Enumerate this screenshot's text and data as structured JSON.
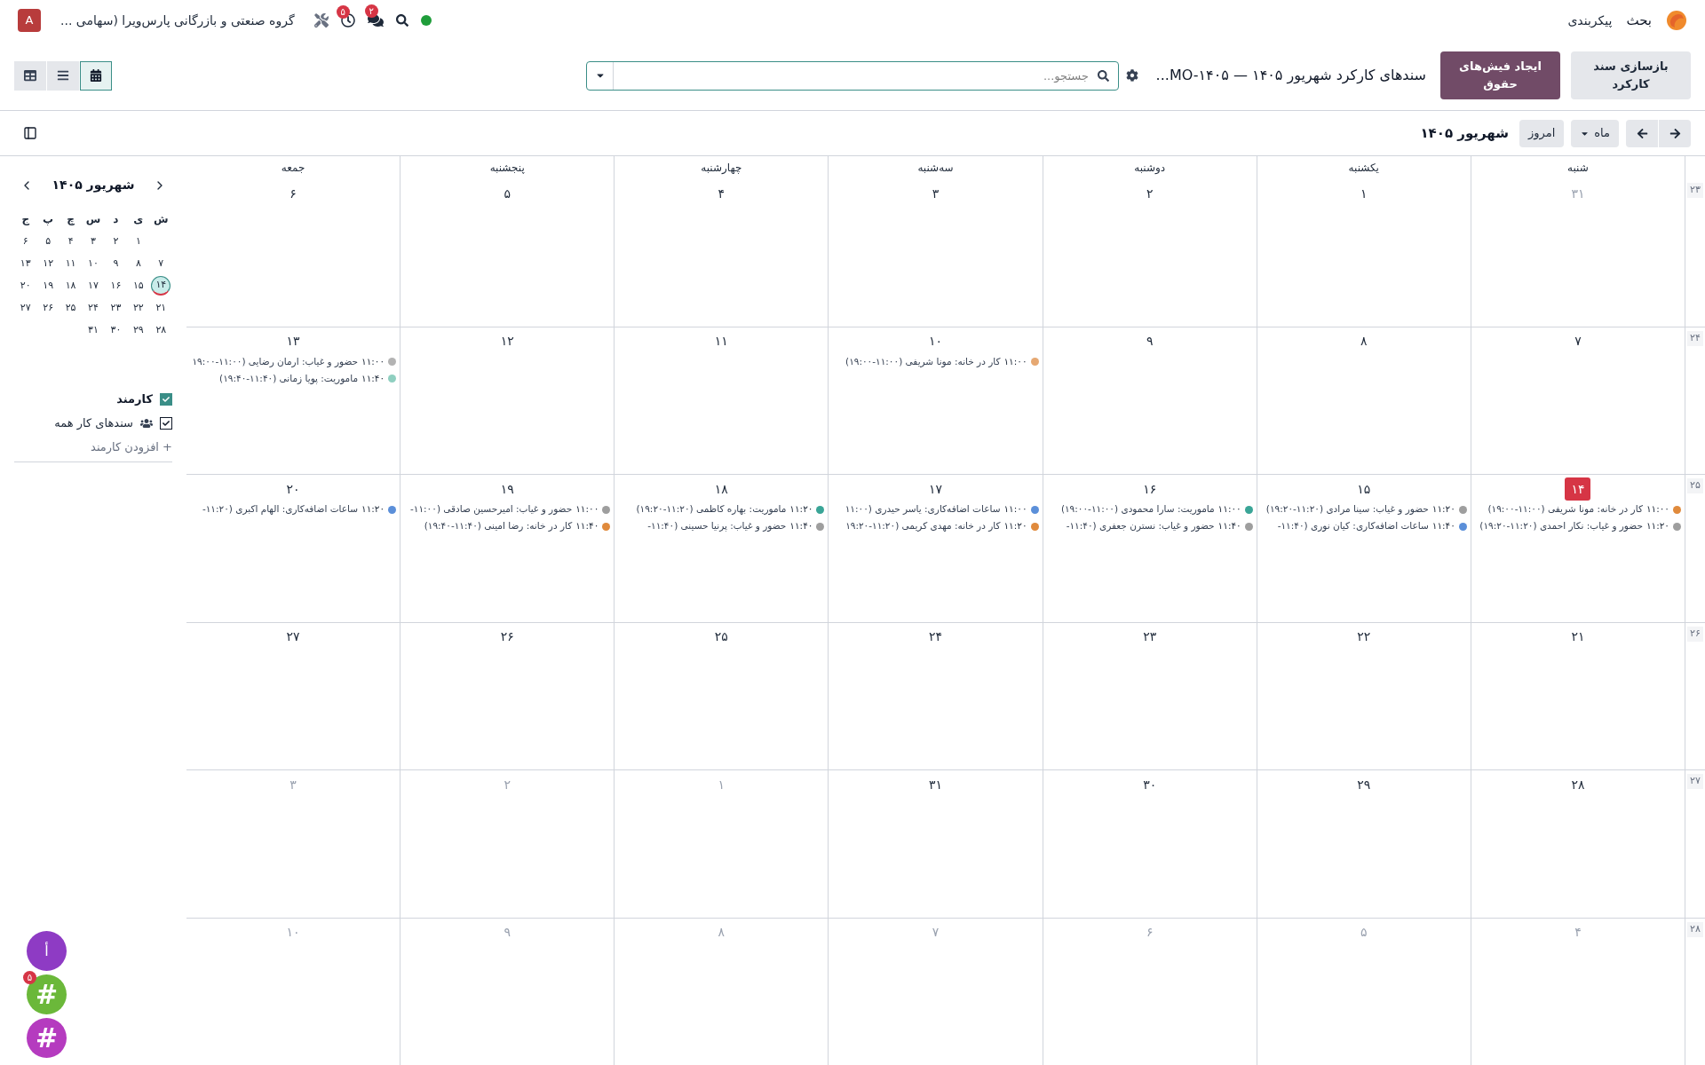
{
  "navbar": {
    "app_name": "بحث",
    "menus": [
      "پیکربندی"
    ],
    "chat_badge": "۲",
    "activity_badge": "۵",
    "company": "گروه صنعتی و بازرگانی پارس‌ویرا (سهامی ...",
    "avatar": "A"
  },
  "control_panel": {
    "buttons": [
      {
        "label": "بازسازی سند کارکرد",
        "kind": "secondary"
      },
      {
        "label": "ایجاد فیش‌های حقوق",
        "kind": "primary"
      }
    ],
    "title": "سندهای کارکرد شهریور ۱۴۰۵ — MO-۱۴۰۵...",
    "search": {
      "placeholder": "جستجو..."
    },
    "views": [
      {
        "kind": "calendar",
        "selected": true
      },
      {
        "kind": "list",
        "selected": false
      },
      {
        "kind": "pivot",
        "selected": false
      }
    ]
  },
  "calendar_toolbar": {
    "scale": "ماه",
    "today": "امروز",
    "period": "شهریور ۱۴۰۵"
  },
  "calendar": {
    "weekdays": [
      "شنبه",
      "یکشنبه",
      "دوشنبه",
      "سه‌شنبه",
      "چهارشنبه",
      "پنجشنبه",
      "جمعه"
    ],
    "weeks": [
      {
        "number": "۲۳",
        "days": [
          {
            "date": "۳۱",
            "other_month": true,
            "today": false
          },
          {
            "date": "۱",
            "other_month": false,
            "today": false
          },
          {
            "date": "۲",
            "other_month": false,
            "today": false
          },
          {
            "date": "۳",
            "other_month": false,
            "today": false
          },
          {
            "date": "۴",
            "other_month": false,
            "today": false
          },
          {
            "date": "۵",
            "other_month": false,
            "today": false
          },
          {
            "date": "۶",
            "other_month": false,
            "today": false
          }
        ]
      },
      {
        "number": "۲۴",
        "days": [
          {
            "date": "۷",
            "other_month": false,
            "today": false
          },
          {
            "date": "۸",
            "other_month": false,
            "today": false
          },
          {
            "date": "۹",
            "other_month": false,
            "today": false
          },
          {
            "date": "۱۰",
            "other_month": false,
            "today": false,
            "events": [
              {
                "time": "۱۱:۰۰",
                "title": "کار در خانه: مونا شریفی (۱۱:۰۰-۱۹:۰۰)",
                "color": "#e6a872"
              }
            ]
          },
          {
            "date": "۱۱",
            "other_month": false,
            "today": false
          },
          {
            "date": "۱۲",
            "other_month": false,
            "today": false
          },
          {
            "date": "۱۳",
            "other_month": false,
            "today": false,
            "events": [
              {
                "time": "۱۱:۰۰",
                "title": "حضور و غیاب: ارمان رضایی (۱۱:۰۰-۱۹:۰۰",
                "color": "#b3b3b3"
              },
              {
                "time": "۱۱:۴۰",
                "title": "ماموریت: پویا زمانی (۱۱:۴۰-۱۹:۴۰)",
                "color": "#8fcfc0"
              }
            ]
          }
        ]
      },
      {
        "number": "۲۵",
        "days": [
          {
            "date": "۱۴",
            "other_month": false,
            "today": true,
            "events": [
              {
                "time": "۱۱:۰۰",
                "title": "کار در خانه: مونا شریفی (۱۱:۰۰-۱۹:۰۰)",
                "color": "#e08a3c"
              },
              {
                "time": "۱۱:۲۰",
                "title": "حضور و غیاب: نکار احمدی (۱۱:۲۰-۱۹:۲۰)",
                "color": "#9e9e9e"
              }
            ]
          },
          {
            "date": "۱۵",
            "other_month": false,
            "today": false,
            "events": [
              {
                "time": "۱۱:۲۰",
                "title": "حضور و غیاب: سینا مرادی (۱۱:۲۰-۱۹:۲۰)",
                "color": "#9e9e9e"
              },
              {
                "time": "۱۱:۴۰",
                "title": "ساعات اضافه‌کاری: کیان نوری (۱۱:۴۰-",
                "color": "#5b8fd9"
              }
            ]
          },
          {
            "date": "۱۶",
            "other_month": false,
            "today": false,
            "events": [
              {
                "time": "۱۱:۰۰",
                "title": "ماموریت: سارا محمودی (۱۱:۰۰-۱۹:۰۰)",
                "color": "#3aa597"
              },
              {
                "time": "۱۱:۴۰",
                "title": "حضور و غیاب: نسترن جعفری (۱۱:۴۰-",
                "color": "#9e9e9e"
              }
            ]
          },
          {
            "date": "۱۷",
            "other_month": false,
            "today": false,
            "events": [
              {
                "time": "۱۱:۰۰",
                "title": "ساعات اضافه‌کاری: یاسر حیدری (۱۱:۰۰",
                "color": "#5b8fd9"
              },
              {
                "time": "۱۱:۲۰",
                "title": "کار در خانه: مهدی کریمی (۱۱:۲۰-۱۹:۲۰",
                "color": "#e08a3c"
              }
            ]
          },
          {
            "date": "۱۸",
            "other_month": false,
            "today": false,
            "events": [
              {
                "time": "۱۱:۲۰",
                "title": "ماموریت: بهاره کاظمی (۱۱:۲۰-۱۹:۲۰)",
                "color": "#3aa597"
              },
              {
                "time": "۱۱:۴۰",
                "title": "حضور و غیاب: پرنیا حسینی (۱۱:۴۰-",
                "color": "#9e9e9e"
              }
            ]
          },
          {
            "date": "۱۹",
            "other_month": false,
            "today": false,
            "events": [
              {
                "time": "۱۱:۰۰",
                "title": "حضور و غیاب: امیرحسین صادقی (۱۱:۰۰-",
                "color": "#9e9e9e"
              },
              {
                "time": "۱۱:۴۰",
                "title": "کار در خانه: رضا امینی (۱۱:۴۰-۱۹:۴۰)",
                "color": "#e08a3c"
              }
            ]
          },
          {
            "date": "۲۰",
            "other_month": false,
            "today": false,
            "events": [
              {
                "time": "۱۱:۲۰",
                "title": "ساعات اضافه‌کاری: الهام اکبری (۱۱:۲۰-",
                "color": "#5b8fd9"
              }
            ]
          }
        ]
      },
      {
        "number": "۲۶",
        "days": [
          {
            "date": "۲۱",
            "other_month": false,
            "today": false
          },
          {
            "date": "۲۲",
            "other_month": false,
            "today": false
          },
          {
            "date": "۲۳",
            "other_month": false,
            "today": false
          },
          {
            "date": "۲۴",
            "other_month": false,
            "today": false
          },
          {
            "date": "۲۵",
            "other_month": false,
            "today": false
          },
          {
            "date": "۲۶",
            "other_month": false,
            "today": false
          },
          {
            "date": "۲۷",
            "other_month": false,
            "today": false
          }
        ]
      },
      {
        "number": "۲۷",
        "days": [
          {
            "date": "۲۸",
            "other_month": false,
            "today": false
          },
          {
            "date": "۲۹",
            "other_month": false,
            "today": false
          },
          {
            "date": "۳۰",
            "other_month": false,
            "today": false
          },
          {
            "date": "۳۱",
            "other_month": false,
            "today": false
          },
          {
            "date": "۱",
            "other_month": true,
            "today": false
          },
          {
            "date": "۲",
            "other_month": true,
            "today": false
          },
          {
            "date": "۳",
            "other_month": true,
            "today": false
          }
        ]
      },
      {
        "number": "۲۸",
        "days": [
          {
            "date": "۴",
            "other_month": true,
            "today": false
          },
          {
            "date": "۵",
            "other_month": true,
            "today": false
          },
          {
            "date": "۶",
            "other_month": true,
            "today": false
          },
          {
            "date": "۷",
            "other_month": true,
            "today": false
          },
          {
            "date": "۸",
            "other_month": true,
            "today": false
          },
          {
            "date": "۹",
            "other_month": true,
            "today": false
          },
          {
            "date": "۱۰",
            "other_month": true,
            "today": false
          }
        ]
      }
    ]
  },
  "sidebar": {
    "mini_calendar": {
      "title": "شهریور ۱۴۰۵",
      "weekdays": [
        "ش",
        "ی",
        "د",
        "س",
        "چ",
        "پ",
        "ج"
      ],
      "weeks": [
        {
          "kind": "start",
          "days": [
            {
              "date": "۱",
              "selected": false
            },
            {
              "date": "۲",
              "selected": false
            },
            {
              "date": "۳",
              "selected": false
            },
            {
              "date": "۴",
              "selected": false
            },
            {
              "date": "۵",
              "selected": false
            },
            {
              "date": "۶",
              "selected": false
            }
          ]
        },
        {
          "kind": "full",
          "days": [
            {
              "date": "۷",
              "selected": false
            },
            {
              "date": "۸",
              "selected": false
            },
            {
              "date": "۹",
              "selected": false
            },
            {
              "date": "۱۰",
              "selected": false
            },
            {
              "date": "۱۱",
              "selected": false
            },
            {
              "date": "۱۲",
              "selected": false
            },
            {
              "date": "۱۳",
              "selected": false
            }
          ]
        },
        {
          "kind": "full",
          "days": [
            {
              "date": "۱۴",
              "selected": true
            },
            {
              "date": "۱۵",
              "selected": false
            },
            {
              "date": "۱۶",
              "selected": false
            },
            {
              "date": "۱۷",
              "selected": false
            },
            {
              "date": "۱۸",
              "selected": false
            },
            {
              "date": "۱۹",
              "selected": false
            },
            {
              "date": "۲۰",
              "selected": false
            }
          ]
        },
        {
          "kind": "full",
          "days": [
            {
              "date": "۲۱",
              "selected": false
            },
            {
              "date": "۲۲",
              "selected": false
            },
            {
              "date": "۲۳",
              "selected": false
            },
            {
              "date": "۲۴",
              "selected": false
            },
            {
              "date": "۲۵",
              "selected": false
            },
            {
              "date": "۲۶",
              "selected": false
            },
            {
              "date": "۲۷",
              "selected": false
            }
          ]
        },
        {
          "kind": "end",
          "days": [
            {
              "date": "۲۸",
              "selected": false
            },
            {
              "date": "۲۹",
              "selected": false
            },
            {
              "date": "۳۰",
              "selected": false
            },
            {
              "date": "۳۱",
              "selected": false
            }
          ]
        }
      ]
    },
    "filters": [
      {
        "kind": "section",
        "label": "کارمند",
        "checked": true
      },
      {
        "kind": "all",
        "label": "سندهای کار همه",
        "checked": true
      }
    ],
    "add_link": "+ افزودن کارمند"
  },
  "chat_bubbles": [
    {
      "kind": "letter",
      "label": "أ",
      "color": "#8e3bc4"
    },
    {
      "kind": "channel",
      "label": "#",
      "badge": "۵",
      "color": "#6bb83a"
    },
    {
      "kind": "channel",
      "label": "#",
      "color": "#b53bbf"
    }
  ]
}
